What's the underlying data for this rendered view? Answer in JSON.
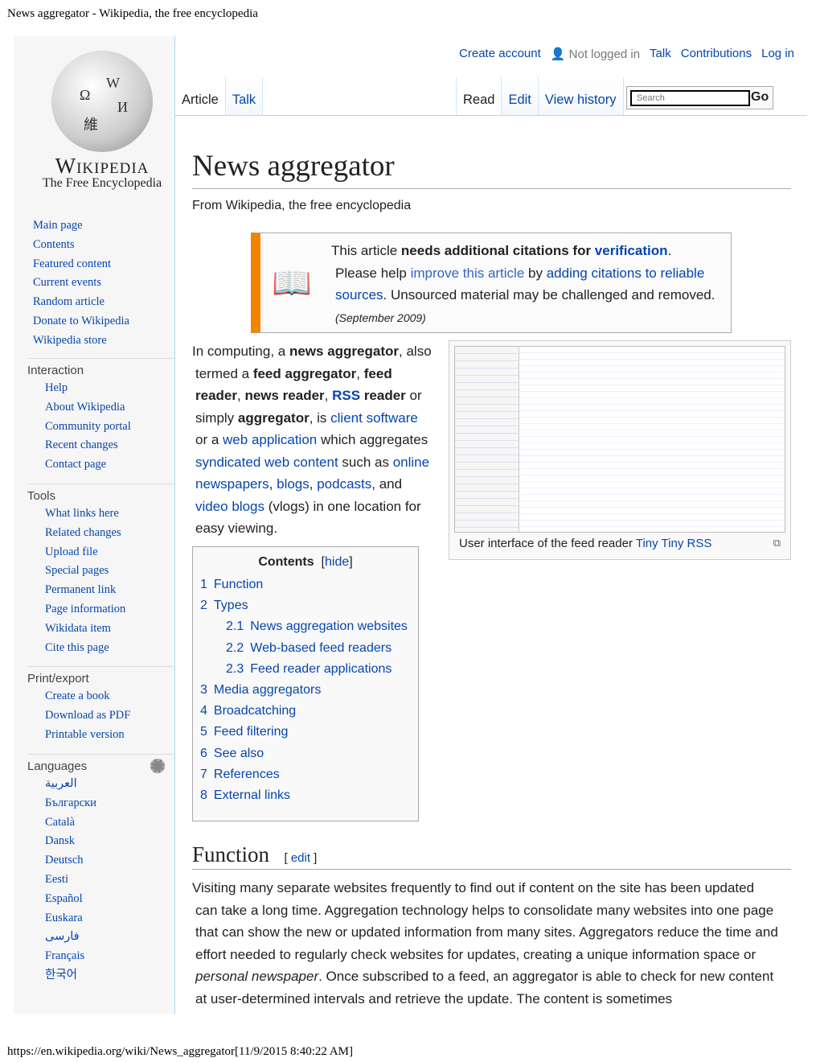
{
  "browser": {
    "page_title": "News aggregator - Wikipedia, the free encyclopedia",
    "footer_url": "https://en.wikipedia.org/wiki/News_aggregator[11/9/2015 8:40:22 AM]"
  },
  "logo": {
    "wordmark": "Wikipedia",
    "tagline": "The Free Encyclopedia"
  },
  "personal": {
    "create_account": "Create account",
    "not_logged_in": "Not logged in",
    "talk": "Talk",
    "contributions": "Contributions",
    "log_in": "Log in"
  },
  "tabs": {
    "article": "Article",
    "talk": "Talk",
    "read": "Read",
    "edit": "Edit",
    "view_history": "View history"
  },
  "search": {
    "placeholder": "Search",
    "go": "Go"
  },
  "sidebar": {
    "nav": [
      "Main page",
      "Contents",
      "Featured content",
      "Current events",
      "Random article",
      "Donate to Wikipedia",
      "Wikipedia store"
    ],
    "interaction": {
      "heading": "Interaction",
      "items": [
        "Help",
        "About Wikipedia",
        "Community portal",
        "Recent changes",
        "Contact page"
      ]
    },
    "tools": {
      "heading": "Tools",
      "items": [
        "What links here",
        "Related changes",
        "Upload file",
        "Special pages",
        "Permanent link",
        "Page information",
        "Wikidata item",
        "Cite this page"
      ]
    },
    "print": {
      "heading": "Print/export",
      "items": [
        "Create a book",
        "Download as PDF",
        "Printable version"
      ]
    },
    "languages": {
      "heading": "Languages",
      "items": [
        "العربية",
        "Български",
        "Català",
        "Dansk",
        "Deutsch",
        "Eesti",
        "Español",
        "Euskara",
        "فارسی",
        "Français",
        "한국어"
      ]
    }
  },
  "article": {
    "title": "News aggregator",
    "subtitle": "From Wikipedia, the free encyclopedia",
    "ambox": {
      "t1": "This article ",
      "t1b": "needs additional citations for ",
      "t1l": "verification",
      "t1e": ".",
      "t2": "Please help ",
      "t2l1": "improve this article",
      "t2m": " by ",
      "t2l2": "adding citations to reliable sources",
      "t2e": ". Unsourced material may be challenged and removed.",
      "date": "(September 2009)"
    },
    "intro": [
      {
        "t": "In computing, a "
      },
      {
        "b": "news aggregator"
      },
      {
        "t": ", also termed a "
      },
      {
        "b": "feed aggregator"
      },
      {
        "t": ", "
      },
      {
        "b": "feed reader"
      },
      {
        "t": ", "
      },
      {
        "b": "news reader"
      },
      {
        "t": ", "
      },
      {
        "bl": "RSS"
      },
      {
        "b": " reader"
      },
      {
        "t": " or simply "
      },
      {
        "b": "aggregator"
      },
      {
        "t": ", is "
      },
      {
        "l": "client software"
      },
      {
        "t": " or a "
      },
      {
        "l": "web application"
      },
      {
        "t": " which aggregates "
      },
      {
        "l": "syndicated web content"
      },
      {
        "t": " such as "
      },
      {
        "l": "online newspapers"
      },
      {
        "t": ", "
      },
      {
        "l": "blogs"
      },
      {
        "t": ", "
      },
      {
        "l": "podcasts"
      },
      {
        "t": ", and "
      },
      {
        "l": "video blogs"
      },
      {
        "t": " (vlogs) in one location for easy viewing."
      }
    ],
    "figure": {
      "caption": "User interface of the feed reader ",
      "caption_link": "Tiny Tiny RSS"
    },
    "toc": {
      "title": "Contents",
      "hide": "hide",
      "entries": [
        {
          "n": "1",
          "t": "Function",
          "lvl": 1
        },
        {
          "n": "2",
          "t": "Types",
          "lvl": 1
        },
        {
          "n": "2.1",
          "t": "News aggregation websites",
          "lvl": 2
        },
        {
          "n": "2.2",
          "t": "Web-based feed readers",
          "lvl": 2
        },
        {
          "n": "2.3",
          "t": "Feed reader applications",
          "lvl": 2
        },
        {
          "n": "3",
          "t": "Media aggregators",
          "lvl": 1
        },
        {
          "n": "4",
          "t": "Broadcatching",
          "lvl": 1
        },
        {
          "n": "5",
          "t": "Feed filtering",
          "lvl": 1
        },
        {
          "n": "6",
          "t": "See also",
          "lvl": 1
        },
        {
          "n": "7",
          "t": "References",
          "lvl": 1
        },
        {
          "n": "8",
          "t": "External links",
          "lvl": 1
        }
      ]
    },
    "function": {
      "heading": "Function",
      "edit": "edit",
      "p1": "Visiting many separate websites frequently to find out if content on the site has been updated can take a long time. Aggregation technology helps to consolidate many websites into one page that can show the new or updated information from many sites. Aggregators reduce the time and effort needed to regularly check websites for updates, creating a unique information space or ",
      "p1i": "personal newspaper",
      "p1e": ". Once subscribed to a feed, an aggregator is able to check for new content at user-determined intervals and retrieve the update. The content is sometimes"
    }
  }
}
